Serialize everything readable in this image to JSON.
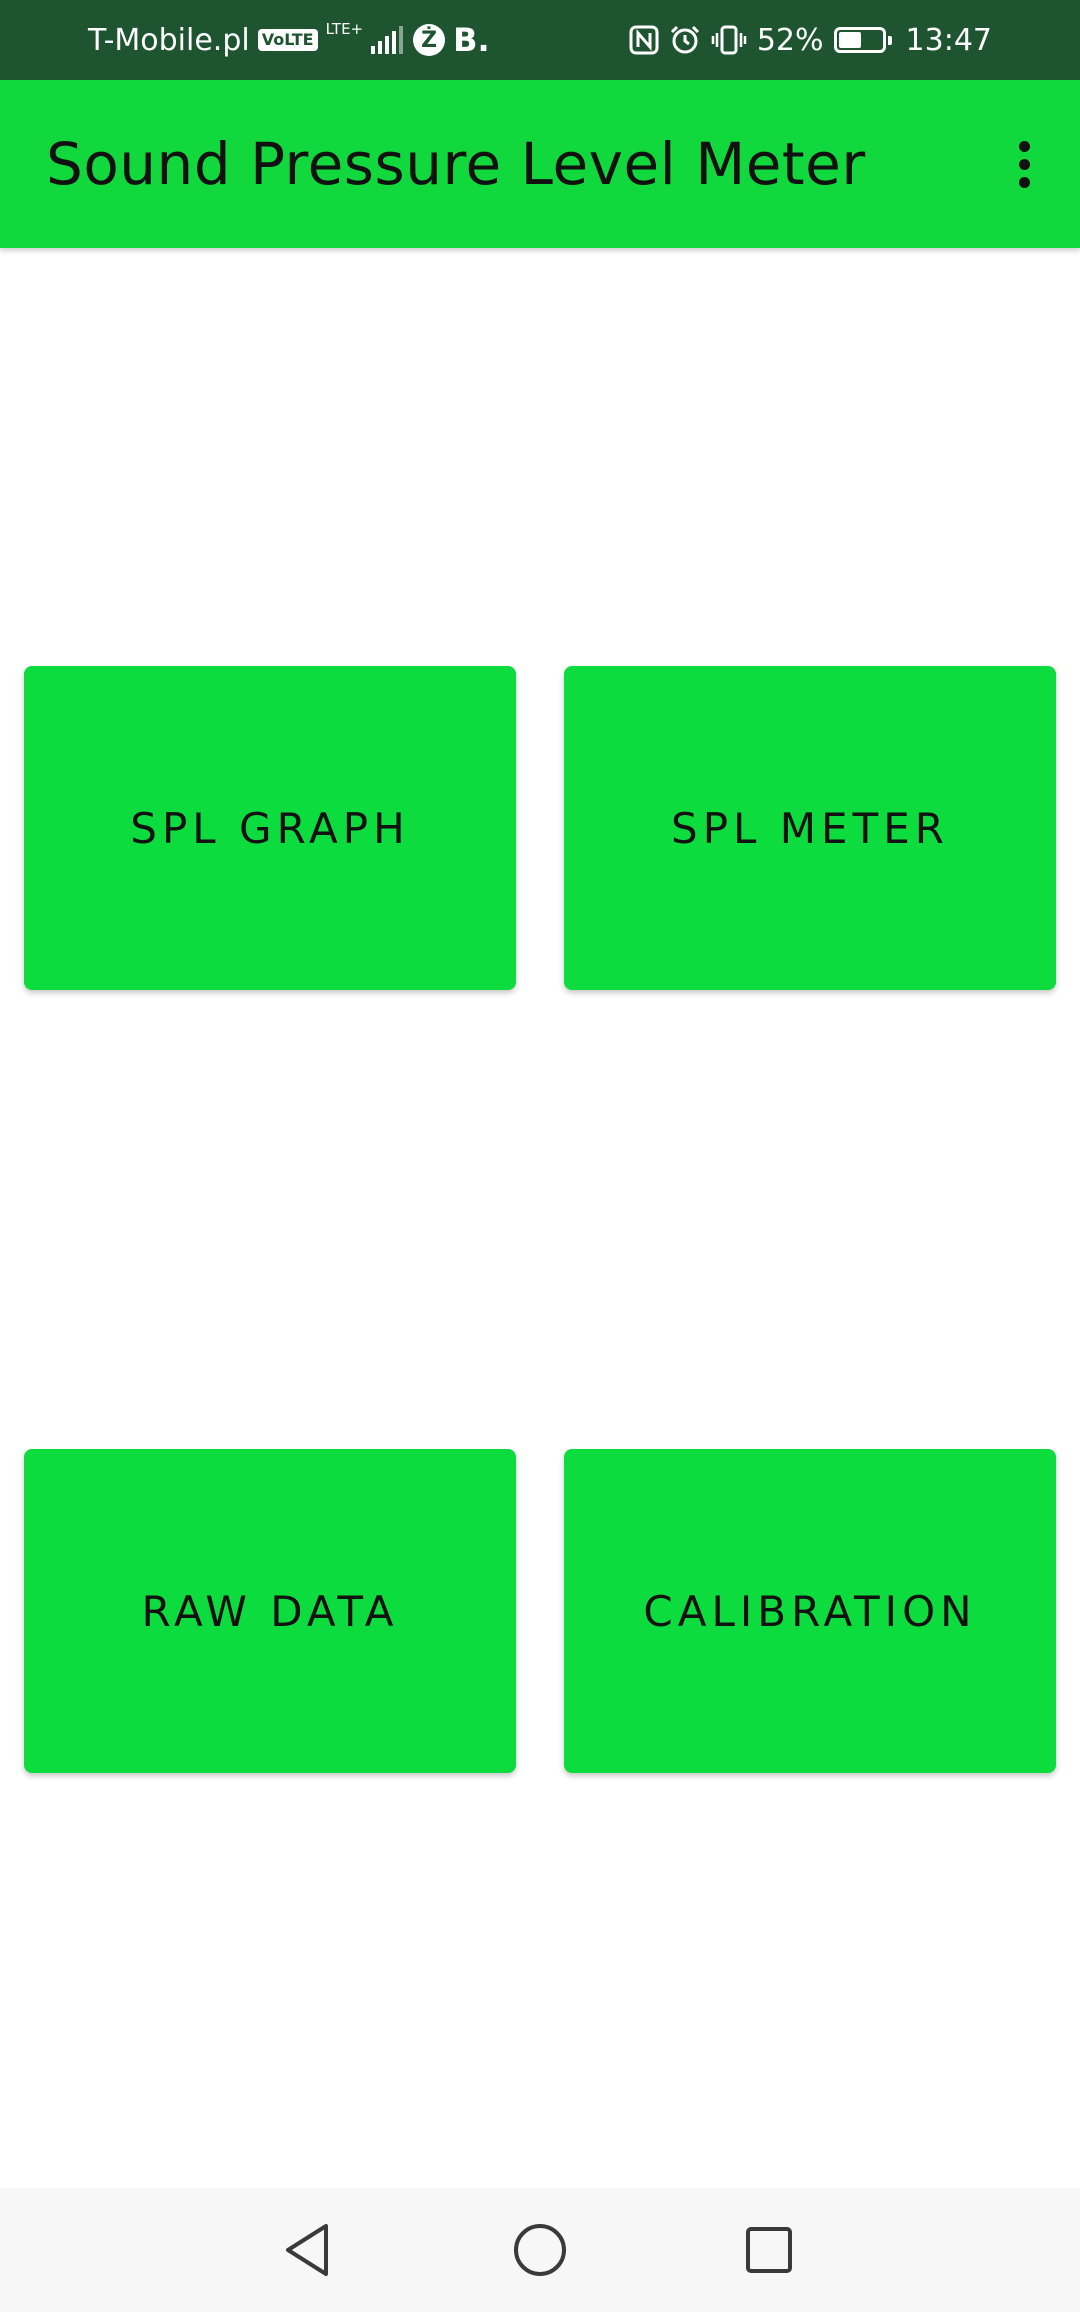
{
  "status_bar": {
    "carrier": "T-Mobile.pl",
    "volte": "VoLTE",
    "network": "LTE+",
    "app_icon_z": "Ż",
    "app_icon_b": "B.",
    "battery_percent": "52%",
    "time": "13:47",
    "battery_level": 0.52
  },
  "app_bar": {
    "title": "Sound Pressure Level Meter",
    "menu_icon": "more-vert-icon"
  },
  "buttons": {
    "spl_graph": "SPL GRAPH",
    "spl_meter": "SPL METER",
    "raw_data": "RAW DATA",
    "calibration": "CALIBRATION"
  },
  "nav_bar": {
    "back_icon": "triangle-back-icon",
    "home_icon": "circle-home-icon",
    "recent_icon": "square-recent-apps-icon"
  },
  "colors": {
    "status_bar": "#1e5530",
    "app_bar": "#10d83d",
    "button": "#0ddc3e",
    "text": "#111111",
    "background": "#ffffff"
  }
}
